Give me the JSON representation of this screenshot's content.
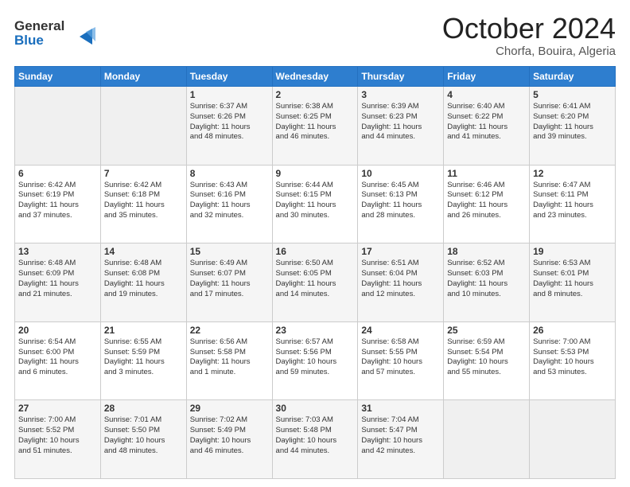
{
  "header": {
    "logo_line1": "General",
    "logo_line2": "Blue",
    "month": "October 2024",
    "location": "Chorfa, Bouira, Algeria"
  },
  "days_of_week": [
    "Sunday",
    "Monday",
    "Tuesday",
    "Wednesday",
    "Thursday",
    "Friday",
    "Saturday"
  ],
  "weeks": [
    [
      {
        "day": "",
        "content": ""
      },
      {
        "day": "",
        "content": ""
      },
      {
        "day": "1",
        "content": "Sunrise: 6:37 AM\nSunset: 6:26 PM\nDaylight: 11 hours\nand 48 minutes."
      },
      {
        "day": "2",
        "content": "Sunrise: 6:38 AM\nSunset: 6:25 PM\nDaylight: 11 hours\nand 46 minutes."
      },
      {
        "day": "3",
        "content": "Sunrise: 6:39 AM\nSunset: 6:23 PM\nDaylight: 11 hours\nand 44 minutes."
      },
      {
        "day": "4",
        "content": "Sunrise: 6:40 AM\nSunset: 6:22 PM\nDaylight: 11 hours\nand 41 minutes."
      },
      {
        "day": "5",
        "content": "Sunrise: 6:41 AM\nSunset: 6:20 PM\nDaylight: 11 hours\nand 39 minutes."
      }
    ],
    [
      {
        "day": "6",
        "content": "Sunrise: 6:42 AM\nSunset: 6:19 PM\nDaylight: 11 hours\nand 37 minutes."
      },
      {
        "day": "7",
        "content": "Sunrise: 6:42 AM\nSunset: 6:18 PM\nDaylight: 11 hours\nand 35 minutes."
      },
      {
        "day": "8",
        "content": "Sunrise: 6:43 AM\nSunset: 6:16 PM\nDaylight: 11 hours\nand 32 minutes."
      },
      {
        "day": "9",
        "content": "Sunrise: 6:44 AM\nSunset: 6:15 PM\nDaylight: 11 hours\nand 30 minutes."
      },
      {
        "day": "10",
        "content": "Sunrise: 6:45 AM\nSunset: 6:13 PM\nDaylight: 11 hours\nand 28 minutes."
      },
      {
        "day": "11",
        "content": "Sunrise: 6:46 AM\nSunset: 6:12 PM\nDaylight: 11 hours\nand 26 minutes."
      },
      {
        "day": "12",
        "content": "Sunrise: 6:47 AM\nSunset: 6:11 PM\nDaylight: 11 hours\nand 23 minutes."
      }
    ],
    [
      {
        "day": "13",
        "content": "Sunrise: 6:48 AM\nSunset: 6:09 PM\nDaylight: 11 hours\nand 21 minutes."
      },
      {
        "day": "14",
        "content": "Sunrise: 6:48 AM\nSunset: 6:08 PM\nDaylight: 11 hours\nand 19 minutes."
      },
      {
        "day": "15",
        "content": "Sunrise: 6:49 AM\nSunset: 6:07 PM\nDaylight: 11 hours\nand 17 minutes."
      },
      {
        "day": "16",
        "content": "Sunrise: 6:50 AM\nSunset: 6:05 PM\nDaylight: 11 hours\nand 14 minutes."
      },
      {
        "day": "17",
        "content": "Sunrise: 6:51 AM\nSunset: 6:04 PM\nDaylight: 11 hours\nand 12 minutes."
      },
      {
        "day": "18",
        "content": "Sunrise: 6:52 AM\nSunset: 6:03 PM\nDaylight: 11 hours\nand 10 minutes."
      },
      {
        "day": "19",
        "content": "Sunrise: 6:53 AM\nSunset: 6:01 PM\nDaylight: 11 hours\nand 8 minutes."
      }
    ],
    [
      {
        "day": "20",
        "content": "Sunrise: 6:54 AM\nSunset: 6:00 PM\nDaylight: 11 hours\nand 6 minutes."
      },
      {
        "day": "21",
        "content": "Sunrise: 6:55 AM\nSunset: 5:59 PM\nDaylight: 11 hours\nand 3 minutes."
      },
      {
        "day": "22",
        "content": "Sunrise: 6:56 AM\nSunset: 5:58 PM\nDaylight: 11 hours\nand 1 minute."
      },
      {
        "day": "23",
        "content": "Sunrise: 6:57 AM\nSunset: 5:56 PM\nDaylight: 10 hours\nand 59 minutes."
      },
      {
        "day": "24",
        "content": "Sunrise: 6:58 AM\nSunset: 5:55 PM\nDaylight: 10 hours\nand 57 minutes."
      },
      {
        "day": "25",
        "content": "Sunrise: 6:59 AM\nSunset: 5:54 PM\nDaylight: 10 hours\nand 55 minutes."
      },
      {
        "day": "26",
        "content": "Sunrise: 7:00 AM\nSunset: 5:53 PM\nDaylight: 10 hours\nand 53 minutes."
      }
    ],
    [
      {
        "day": "27",
        "content": "Sunrise: 7:00 AM\nSunset: 5:52 PM\nDaylight: 10 hours\nand 51 minutes."
      },
      {
        "day": "28",
        "content": "Sunrise: 7:01 AM\nSunset: 5:50 PM\nDaylight: 10 hours\nand 48 minutes."
      },
      {
        "day": "29",
        "content": "Sunrise: 7:02 AM\nSunset: 5:49 PM\nDaylight: 10 hours\nand 46 minutes."
      },
      {
        "day": "30",
        "content": "Sunrise: 7:03 AM\nSunset: 5:48 PM\nDaylight: 10 hours\nand 44 minutes."
      },
      {
        "day": "31",
        "content": "Sunrise: 7:04 AM\nSunset: 5:47 PM\nDaylight: 10 hours\nand 42 minutes."
      },
      {
        "day": "",
        "content": ""
      },
      {
        "day": "",
        "content": ""
      }
    ]
  ]
}
